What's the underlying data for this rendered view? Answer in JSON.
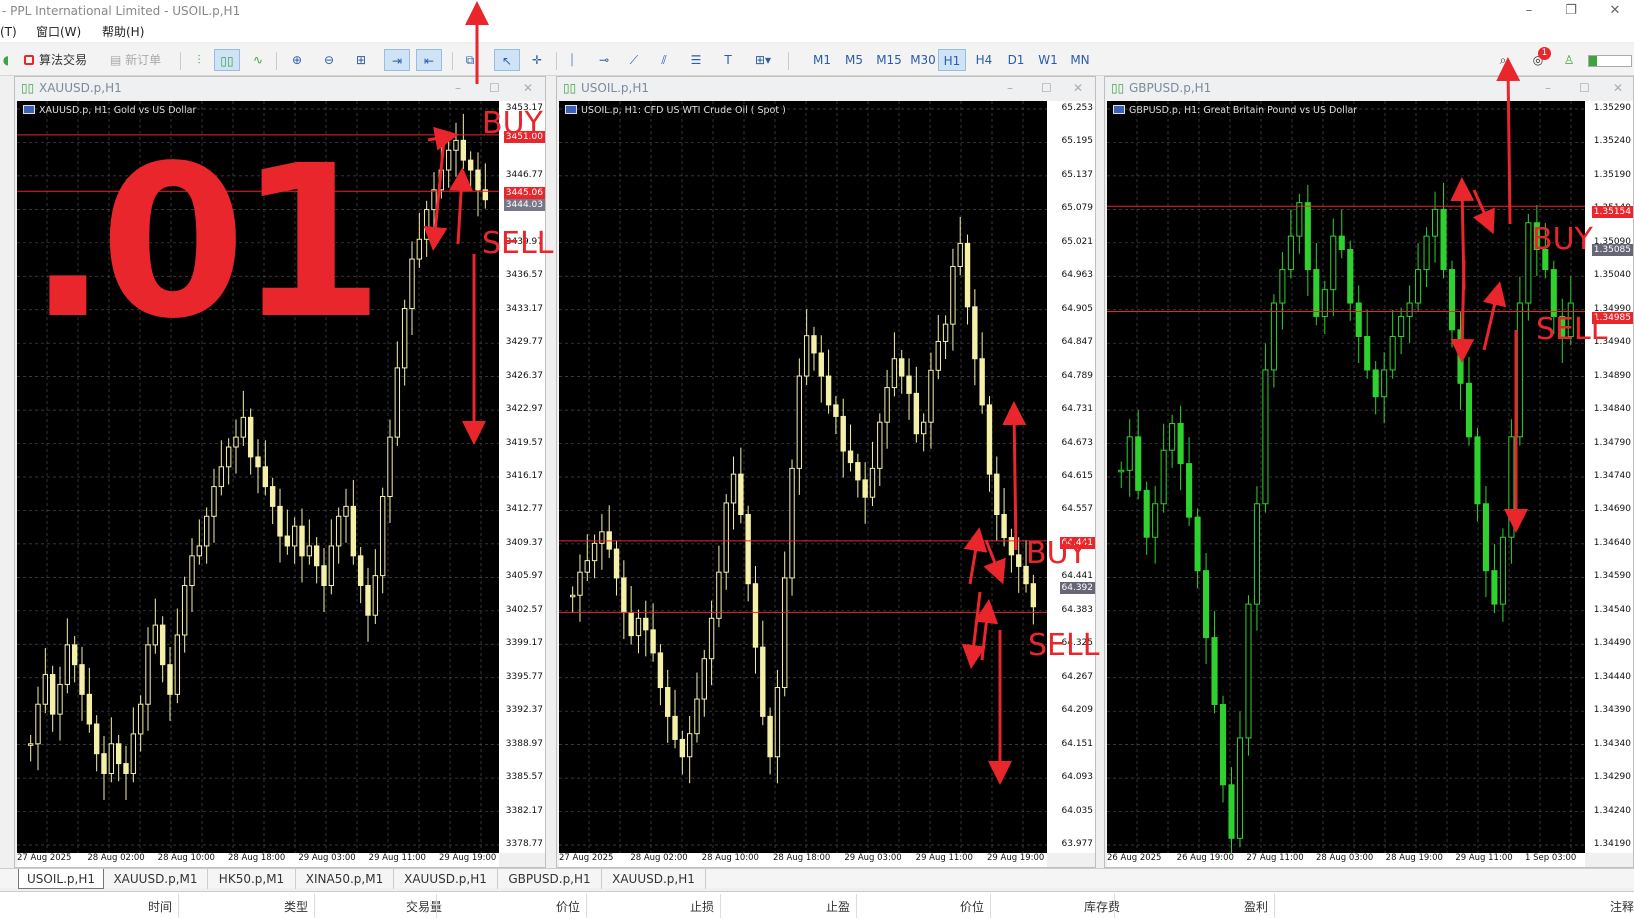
{
  "window": {
    "title": "- PPL International Limited - USOIL.p,H1",
    "controls": [
      "–",
      "❐",
      "✕"
    ]
  },
  "menu": [
    {
      "label": "(T)"
    },
    {
      "label": "窗口(W)"
    },
    {
      "label": "帮助(H)"
    }
  ],
  "toolbar": {
    "algo_trading": "算法交易",
    "new_order": "新订单",
    "timeframes": [
      "M1",
      "M5",
      "M15",
      "M30",
      "H1",
      "H4",
      "D1",
      "W1",
      "MN"
    ],
    "active_timeframe": "H1",
    "notification_count": "1"
  },
  "charts": [
    {
      "window_title": "XAUUSD.p,H1",
      "symbol_label": "XAUUSD.p, H1:  Gold vs US Dollar",
      "y_labels": [
        "3453.17",
        "3450.17",
        "3446.77",
        "3443.37",
        "3439.97",
        "3436.57",
        "3433.17",
        "3429.77",
        "3426.37",
        "3422.97",
        "3419.57",
        "3416.17",
        "3412.77",
        "3409.37",
        "3405.97",
        "3402.57",
        "3399.17",
        "3395.77",
        "3392.37",
        "3388.97",
        "3385.57",
        "3382.17",
        "3378.77"
      ],
      "x_labels": [
        "27 Aug 2025",
        "28 Aug 02:00",
        "28 Aug 10:00",
        "28 Aug 18:00",
        "29 Aug 03:00",
        "29 Aug 11:00",
        "29 Aug 19:00"
      ],
      "price_tags": [
        "3451.00",
        "3445.06",
        "3444.03"
      ],
      "candle_color": "#f5f0a8",
      "candles": [
        3389,
        3393,
        3396,
        3392,
        3395,
        3399,
        3397,
        3394,
        3391,
        3388,
        3386,
        3389,
        3387,
        3386,
        3390,
        3393,
        3399,
        3401,
        3397,
        3394,
        3400,
        3405,
        3408,
        3409,
        3412,
        3415,
        3417,
        3419,
        3420,
        3422,
        3418,
        3417,
        3415,
        3413,
        3410,
        3409,
        3411,
        3408,
        3409,
        3407,
        3405,
        3409,
        3412,
        3413,
        3408,
        3405,
        3402,
        3406,
        3414,
        3420,
        3427,
        3433,
        3438,
        3440,
        3443,
        3445,
        3447,
        3449,
        3450,
        3448,
        3447,
        3445,
        3444
      ]
    },
    {
      "window_title": "USOIL.p,H1",
      "symbol_label": "USOIL.p, H1:  CFD US WTI Crude Oil ( Spot )",
      "y_labels": [
        "65.253",
        "65.195",
        "65.137",
        "65.079",
        "65.021",
        "64.963",
        "64.905",
        "64.847",
        "64.789",
        "64.731",
        "64.673",
        "64.615",
        "64.557",
        "64.499",
        "64.441",
        "64.383",
        "64.325",
        "64.267",
        "64.209",
        "64.151",
        "64.093",
        "64.035",
        "63.977"
      ],
      "x_labels": [
        "27 Aug 2025",
        "28 Aug 02:00",
        "28 Aug 10:00",
        "28 Aug 18:00",
        "29 Aug 03:00",
        "29 Aug 11:00",
        "29 Aug 19:00"
      ],
      "price_tags": [
        "64.441",
        "64.392"
      ],
      "candle_color": "#f5f0a8",
      "candles": [
        64.41,
        64.45,
        64.47,
        64.5,
        64.52,
        64.49,
        64.44,
        64.38,
        64.34,
        64.37,
        64.35,
        64.31,
        64.25,
        64.2,
        64.16,
        64.13,
        64.17,
        64.23,
        64.3,
        64.37,
        64.45,
        64.57,
        64.62,
        64.55,
        64.43,
        64.32,
        64.2,
        64.13,
        64.25,
        64.44,
        64.63,
        64.79,
        64.86,
        64.83,
        64.79,
        64.74,
        64.72,
        64.66,
        64.64,
        64.61,
        64.58,
        64.63,
        64.71,
        64.77,
        64.82,
        64.79,
        64.76,
        64.69,
        64.71,
        64.8,
        64.85,
        64.88,
        64.98,
        65.02,
        64.91,
        64.82,
        64.74,
        64.62,
        64.55,
        64.51,
        64.48,
        64.46,
        64.43,
        64.39
      ]
    },
    {
      "window_title": "GBPUSD.p,H1",
      "symbol_label": "GBPUSD.p, H1:  Great Britain Pound vs US Dollar",
      "y_labels": [
        "1.35290",
        "1.35240",
        "1.35190",
        "1.35140",
        "1.35090",
        "1.35040",
        "1.34990",
        "1.34940",
        "1.34890",
        "1.34840",
        "1.34790",
        "1.34740",
        "1.34690",
        "1.34640",
        "1.34590",
        "1.34540",
        "1.34490",
        "1.34440",
        "1.34390",
        "1.34340",
        "1.34290",
        "1.34240",
        "1.34190"
      ],
      "x_labels": [
        "26 Aug 2025",
        "26 Aug 19:00",
        "27 Aug 11:00",
        "28 Aug 03:00",
        "28 Aug 19:00",
        "29 Aug 11:00",
        "1 Sep 03:00"
      ],
      "price_tags": [
        "1.35154",
        "1.35085",
        "1.34985"
      ],
      "candle_color": "#2fd12f",
      "candles": [
        1.3475,
        1.348,
        1.3472,
        1.3465,
        1.347,
        1.3478,
        1.3482,
        1.3476,
        1.3468,
        1.346,
        1.345,
        1.344,
        1.3428,
        1.342,
        1.3435,
        1.3455,
        1.347,
        1.349,
        1.35,
        1.3505,
        1.351,
        1.3515,
        1.3505,
        1.3498,
        1.3502,
        1.351,
        1.3508,
        1.35,
        1.3495,
        1.349,
        1.3486,
        1.349,
        1.3495,
        1.3498,
        1.35,
        1.3505,
        1.351,
        1.3514,
        1.3505,
        1.3496,
        1.3488,
        1.348,
        1.347,
        1.346,
        1.3455,
        1.3465,
        1.348,
        1.35,
        1.3512,
        1.3508,
        1.3505,
        1.3498,
        1.3495,
        1.35
      ]
    }
  ],
  "annotations": {
    "big_text": ".01",
    "buy": "BUY",
    "sell": "SELL"
  },
  "tabs": [
    "USOIL.p,H1",
    "XAUUSD.p,M1",
    "HK50.p,M1",
    "XINA50.p,M1",
    "XAUUSD.p,H1",
    "GBPUSD.p,H1",
    "XAUUSD.p,H1"
  ],
  "active_tab": "USOIL.p,H1",
  "columns": [
    "时间",
    "类型",
    "交易量",
    "价位",
    "止损",
    "止盈",
    "价位",
    "库存费",
    "盈利",
    "注释"
  ],
  "colors": {
    "accent": "#2a5caa",
    "annotation": "#e8262c",
    "chart_bg": "#000000",
    "grid": "#4a4a4a"
  }
}
